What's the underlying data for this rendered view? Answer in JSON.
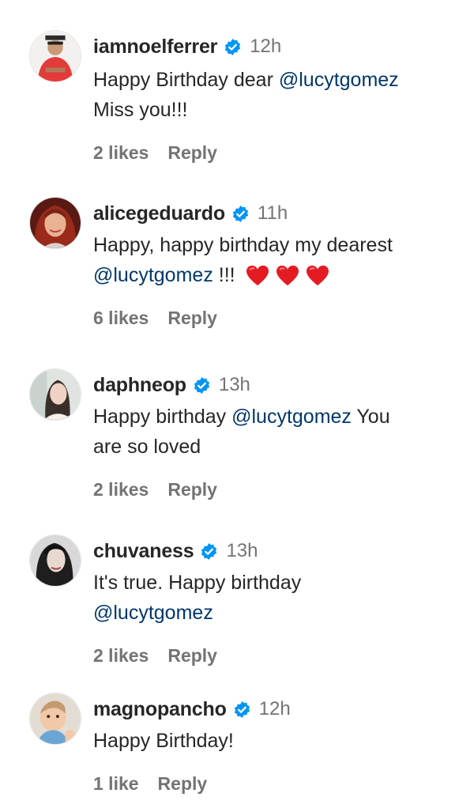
{
  "comments": [
    {
      "username": "iamnoelferrer",
      "time": "12h",
      "text_parts": [
        "Happy Birthday dear ",
        "@lucytgomez",
        "Miss you!!!"
      ],
      "likes": "2 likes",
      "reply": "Reply"
    },
    {
      "username": "alicegeduardo",
      "time": "11h",
      "text_parts": [
        "Happy, happy birthday my dearest",
        "@lucytgomez",
        " !!!"
      ],
      "likes": "6 likes",
      "reply": "Reply",
      "hearts": [
        "red-heart-emoji",
        "red-heart-emoji",
        "red-heart-emoji"
      ]
    },
    {
      "username": "daphneop",
      "time": "13h",
      "text_parts": [
        "Happy birthday ",
        "@lucytgomez",
        " You",
        "are so loved"
      ],
      "likes": "2 likes",
      "reply": "Reply"
    },
    {
      "username": "chuvaness",
      "time": "13h",
      "text_parts": [
        "It's true. Happy birthday",
        "@lucytgomez"
      ],
      "likes": "2 likes",
      "reply": "Reply"
    },
    {
      "username": "magnopancho",
      "time": "12h",
      "text_parts": [
        "Happy Birthday!"
      ],
      "likes": "1 like",
      "reply": "Reply"
    }
  ],
  "colors": {
    "text": "#262626",
    "muted": "#737373",
    "mention": "#00376b",
    "verified": "#0095f6",
    "heart": "#e41b23"
  },
  "icons": {
    "verified": "verified-badge-icon",
    "heart": "red-heart-emoji"
  }
}
